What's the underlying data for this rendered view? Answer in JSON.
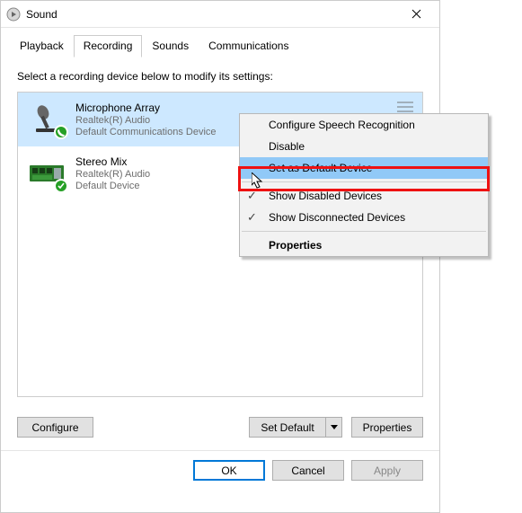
{
  "window": {
    "title": "Sound"
  },
  "tabs": [
    {
      "label": "Playback"
    },
    {
      "label": "Recording"
    },
    {
      "label": "Sounds"
    },
    {
      "label": "Communications"
    }
  ],
  "subheading": "Select a recording device below to modify its settings:",
  "devices": [
    {
      "name": "Microphone Array",
      "driver": "Realtek(R) Audio",
      "status": "Default Communications Device",
      "icon": "microphone-icon",
      "badge": "phone"
    },
    {
      "name": "Stereo Mix",
      "driver": "Realtek(R) Audio",
      "status": "Default Device",
      "icon": "soundcard-icon",
      "badge": "check"
    }
  ],
  "buttons": {
    "configure": "Configure",
    "set_default": "Set Default",
    "properties": "Properties",
    "ok": "OK",
    "cancel": "Cancel",
    "apply": "Apply"
  },
  "context_menu": {
    "items": [
      {
        "label": "Configure Speech Recognition"
      },
      {
        "label": "Disable"
      },
      {
        "label": "Set as Default Device",
        "highlight": true
      },
      {
        "sep": true
      },
      {
        "label": "Show Disabled Devices",
        "checked": true
      },
      {
        "label": "Show Disconnected Devices",
        "checked": true
      },
      {
        "sep": true
      },
      {
        "label": "Properties",
        "bold": true
      }
    ]
  }
}
